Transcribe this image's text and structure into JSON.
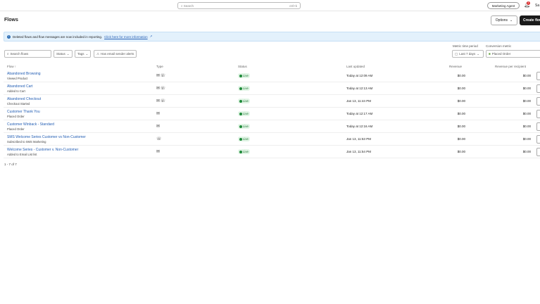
{
  "topbar": {
    "search_placeholder": "Search",
    "shortcut": "ctrl+k",
    "agent": "Marketing Agent",
    "notifications": "1",
    "user": "Sa"
  },
  "page": {
    "title": "Flows",
    "options": "Options",
    "create": "Create flow"
  },
  "banner": {
    "text": "Deleted flows and flow messages are now included in reporting.",
    "link": "Click here for more information"
  },
  "filters": {
    "search_placeholder": "Search flows",
    "status": "Status",
    "tags": "Tags",
    "alerts": "Has email sender alerts",
    "metric_period_label": "Metric time period",
    "metric_period": "Last 7 days",
    "conversion_label": "Conversion metric",
    "conversion": "Placed Order"
  },
  "columns": {
    "flow": "Flow ↑",
    "type": "Type",
    "status": "Status",
    "updated": "Last updated",
    "revenue": "Revenue",
    "rpr": "Revenue per recipient"
  },
  "rows": [
    {
      "name": "Abandoned Browsing",
      "trigger": "Viewed Product",
      "type": "✉☏",
      "status": "Live",
      "updated": "Today at 12:09 AM",
      "revenue": "$0.00",
      "rpr": "$0.00"
    },
    {
      "name": "Abandoned Cart",
      "trigger": "Added to Cart",
      "type": "✉☏",
      "status": "Live",
      "updated": "Today at 12:13 AM",
      "revenue": "$0.00",
      "rpr": "$0.00"
    },
    {
      "name": "Abandoned Checkout",
      "trigger": "Checkout Started",
      "type": "✉☏",
      "status": "Live",
      "updated": "Jan 13, 11:44 PM",
      "revenue": "$0.00",
      "rpr": "$0.00"
    },
    {
      "name": "Customer Thank You",
      "trigger": "Placed Order",
      "type": "✉",
      "status": "Live",
      "updated": "Today at 12:17 AM",
      "revenue": "$0.00",
      "rpr": "$0.00"
    },
    {
      "name": "Customer Winback - Standard",
      "trigger": "Placed Order",
      "type": "✉",
      "status": "Live",
      "updated": "Today at 12:16 AM",
      "revenue": "$0.00",
      "rpr": "$0.00"
    },
    {
      "name": "SMS Welcome Series Customer vs Non-Customer",
      "trigger": "Subscribed to SMS Marketing",
      "type": "☏",
      "status": "Live",
      "updated": "Jan 13, 11:53 PM",
      "revenue": "$0.00",
      "rpr": "$0.00"
    },
    {
      "name": "Welcome Series - Customer v. Non-Customer",
      "trigger": "Added to Email List list",
      "type": "✉",
      "status": "Live",
      "updated": "Jan 13, 11:54 PM",
      "revenue": "$0.00",
      "rpr": "$0.00"
    }
  ],
  "pagination": "1 - 7 of 7"
}
